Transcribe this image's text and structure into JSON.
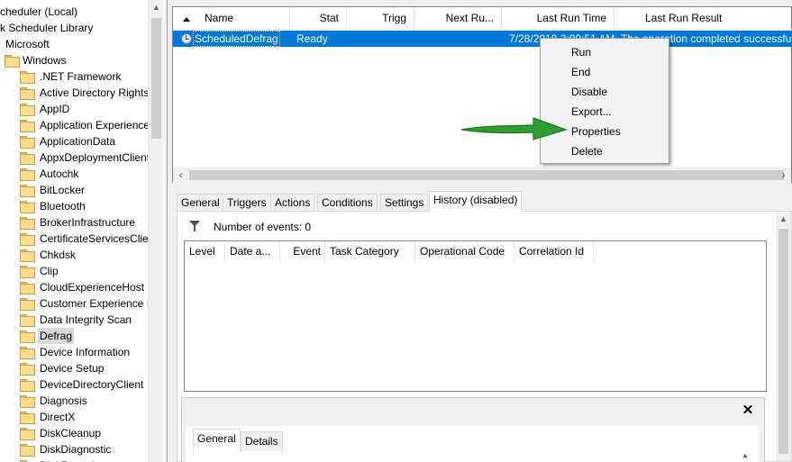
{
  "tree": {
    "header_items": [
      {
        "label": "cheduler (Local)",
        "indent": 0,
        "folder": false
      },
      {
        "label": "k Scheduler Library",
        "indent": 0,
        "folder": false
      },
      {
        "label": "Microsoft",
        "indent": 1,
        "folder": false
      },
      {
        "label": "Windows",
        "indent": 2,
        "folder": true
      }
    ],
    "items": [
      ".NET Framework",
      "Active Directory Rights",
      "AppID",
      "Application Experience",
      "ApplicationData",
      "AppxDeploymentClient",
      "Autochk",
      "BitLocker",
      "Bluetooth",
      "BrokerInfrastructure",
      "CertificateServicesClient",
      "Chkdsk",
      "Clip",
      "CloudExperienceHost",
      "Customer Experience In",
      "Data Integrity Scan",
      "Defrag",
      "Device Information",
      "Device Setup",
      "DeviceDirectoryClient",
      "Diagnosis",
      "DirectX",
      "DiskCleanup",
      "DiskDiagnostic",
      "DiskFootprint"
    ],
    "selected": "Defrag"
  },
  "task_list": {
    "columns": [
      "Name",
      "Stat",
      "Trigg",
      "Next Ru...",
      "Last Run Time",
      "Last Run Result"
    ],
    "row": {
      "name": "ScheduledDefrag",
      "status": "Ready",
      "last_run_time": "7/28/2018 3:00:51 AM",
      "last_run_result": "The operation completed successfully"
    }
  },
  "context_menu": {
    "items": [
      "Run",
      "End",
      "Disable",
      "Export...",
      "Properties",
      "Delete"
    ]
  },
  "tabs": [
    "General",
    "Triggers",
    "Actions",
    "Conditions",
    "Settings",
    "History (disabled)"
  ],
  "history": {
    "events_label": "Number of events: 0",
    "columns": [
      "Level",
      "Date a...",
      "Event",
      "Task Category",
      "Operational Code",
      "Correlation Id"
    ]
  },
  "detail": {
    "close": "✕",
    "tabs": [
      "General",
      "Details"
    ]
  },
  "colors": {
    "selection": "#0078d7",
    "arrow": "#2e9e2e",
    "folder": "#f8dc8c"
  }
}
